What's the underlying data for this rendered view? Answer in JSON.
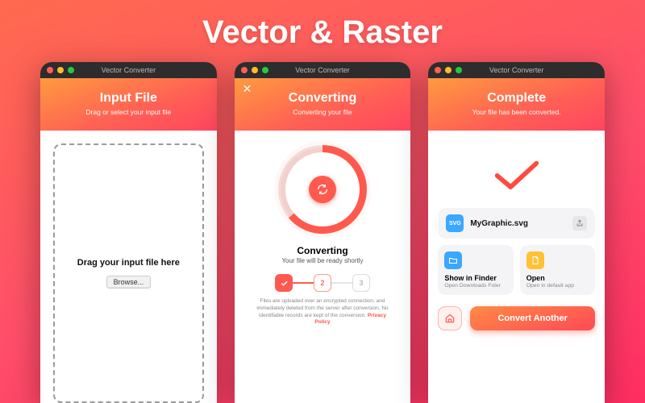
{
  "hero": "Vector & Raster",
  "windowTitle": "Vector Converter",
  "colors": {
    "accent": "#ff5a4f",
    "grad1": "#ff9a3f",
    "grad2": "#ff4560"
  },
  "screen1": {
    "title": "Input File",
    "subtitle": "Drag or select your input file",
    "dropMessage": "Drag your input file here",
    "browseLabel": "Browse..."
  },
  "screen2": {
    "title": "Converting",
    "subtitle": "Converting your file",
    "statusTitle": "Converting",
    "statusSubtitle": "Your file will be ready shortly",
    "steps": [
      "done",
      "2",
      "3"
    ],
    "finePrint": "Files are uploaded over an encrypted connection, and immediately deleted from the server after conversion. No identifiable records are kept of the conversion.",
    "privacyLabel": "Privacy Policy"
  },
  "screen3": {
    "title": "Complete",
    "subtitle": "Your file has been converted.",
    "file": {
      "name": "MyGraphic.svg",
      "iconText": "SVG"
    },
    "actions": {
      "finder": {
        "title": "Show in Finder",
        "subtitle": "Open Downloads Foler"
      },
      "open": {
        "title": "Open",
        "subtitle": "Open in default app"
      }
    },
    "convertAnother": "Convert Another"
  }
}
